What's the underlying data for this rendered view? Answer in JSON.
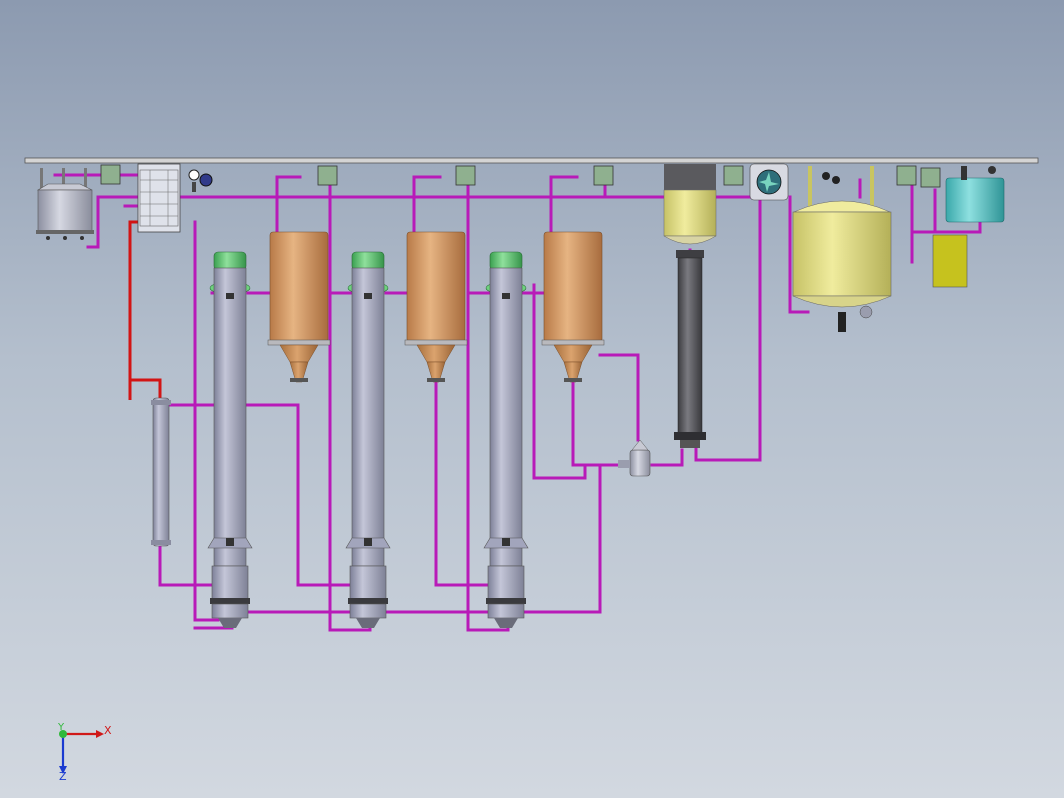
{
  "axis_triad": {
    "x_label": "X",
    "y_label": "Y",
    "z_label": "Z"
  },
  "colors": {
    "pipe_process": "#b81ab8",
    "pipe_steam": "#d21414",
    "header_beam": "#c8c8c8",
    "column_body": "#a9acc4",
    "column_cap": "#5bc470",
    "separator_body": "#d9a06b",
    "separator_cone": "#c98a4e",
    "condenser_top": "#e8e4a8",
    "condenser_column": "#5c5c60",
    "storage_tank": "#e4e088",
    "cyan_tank": "#5ec8c8",
    "olive_box": "#c6c21e",
    "small_tank": "#b8bbc8",
    "pump": "#2e6e7a",
    "valve_box": "#8fb08f"
  },
  "equipment": [
    {
      "id": "feed-tank",
      "icon": "small-tank-icon"
    },
    {
      "id": "plate-heat-exchanger",
      "icon": "heat-exchanger-icon"
    },
    {
      "id": "preheater",
      "icon": "preheater-icon"
    },
    {
      "id": "evaporator-1",
      "icon": "falling-film-column-icon"
    },
    {
      "id": "evaporator-2",
      "icon": "falling-film-column-icon"
    },
    {
      "id": "evaporator-3",
      "icon": "falling-film-column-icon"
    },
    {
      "id": "separator-1",
      "icon": "separator-icon"
    },
    {
      "id": "separator-2",
      "icon": "separator-icon"
    },
    {
      "id": "separator-3",
      "icon": "separator-icon"
    },
    {
      "id": "condenser",
      "icon": "condenser-icon"
    },
    {
      "id": "condensate-pump",
      "icon": "pump-icon"
    },
    {
      "id": "storage-tank",
      "icon": "jacketed-tank-icon"
    },
    {
      "id": "cyan-tank",
      "icon": "tank-icon"
    },
    {
      "id": "olive-box",
      "icon": "box-icon"
    }
  ]
}
